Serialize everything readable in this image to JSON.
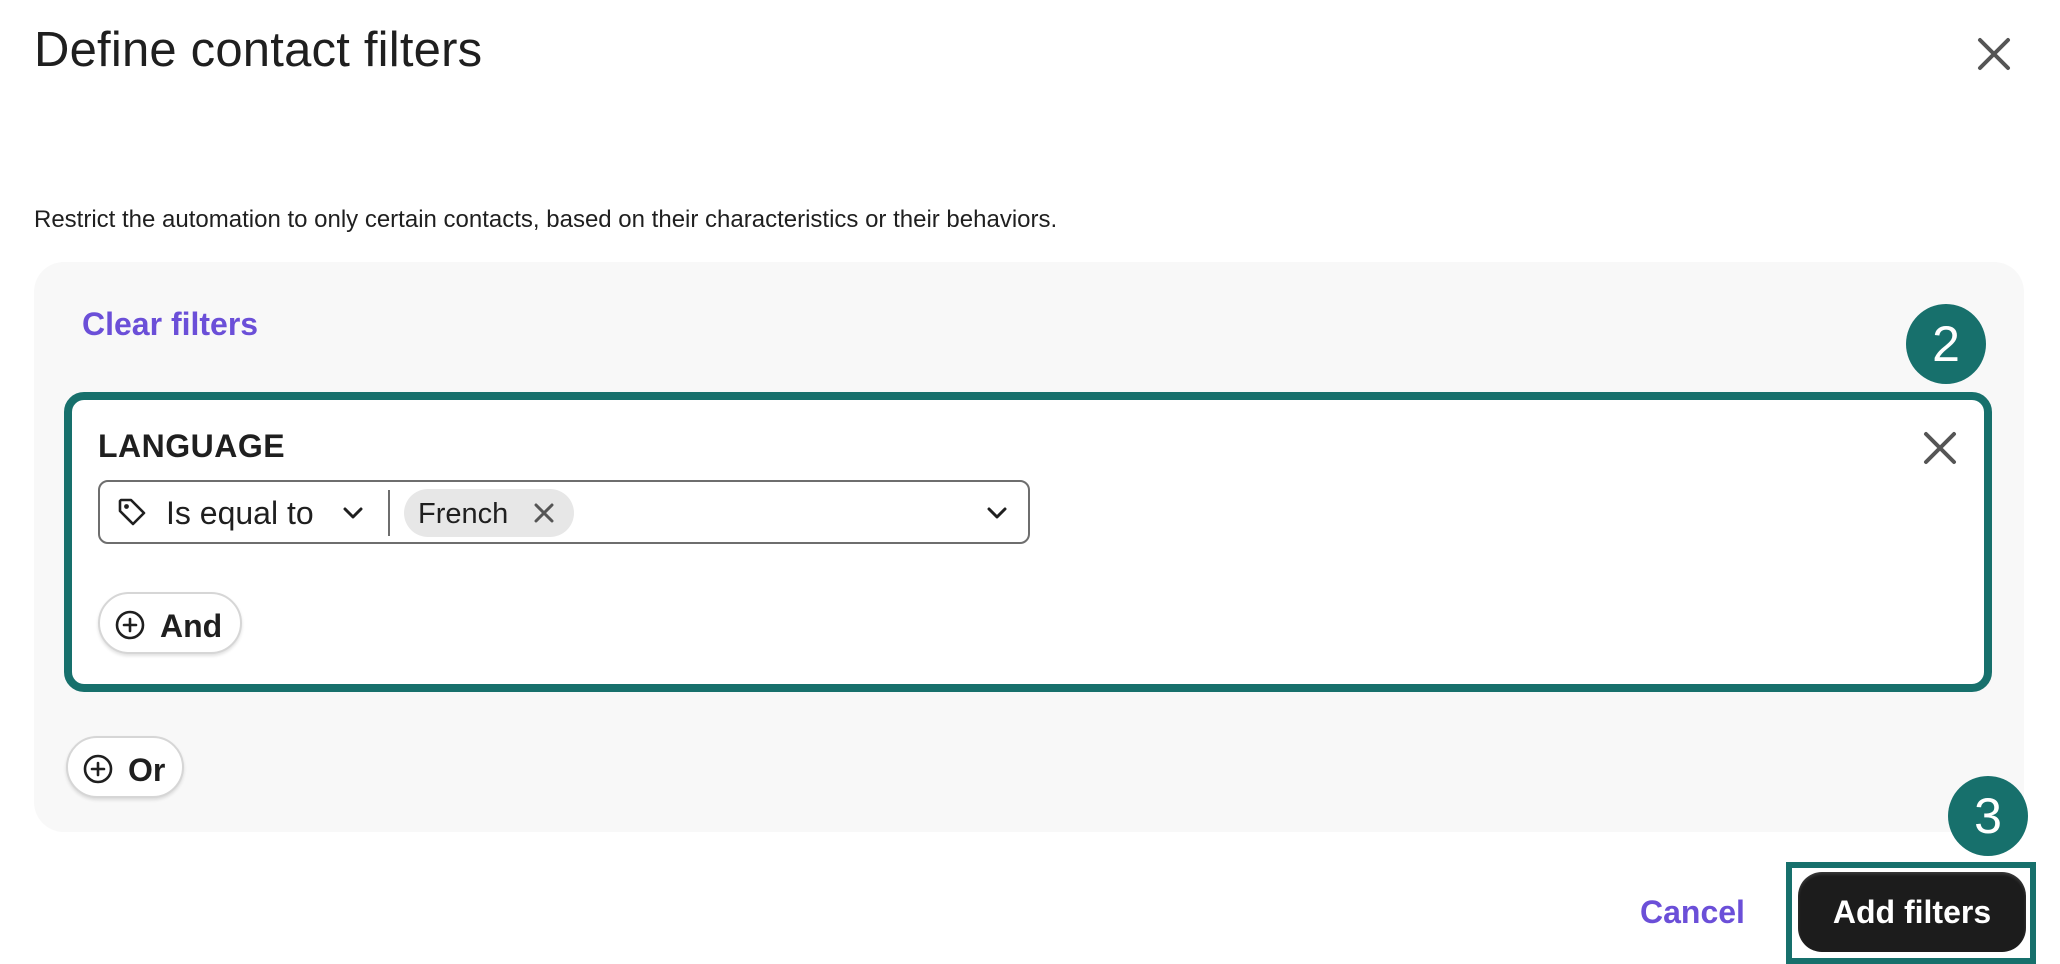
{
  "dialog": {
    "title": "Define contact filters",
    "description": "Restrict the automation to only certain contacts, based on their characteristics or their behaviors."
  },
  "panel": {
    "clear_filters_label": "Clear filters",
    "group": {
      "label": "LANGUAGE",
      "condition": {
        "operator": "Is equal to",
        "values": [
          "French"
        ]
      },
      "and_label": "And"
    },
    "or_label": "Or"
  },
  "footer": {
    "cancel_label": "Cancel",
    "add_label": "Add filters"
  },
  "annotations": {
    "step_2": "2",
    "step_3": "3"
  },
  "colors": {
    "accent_purple": "#6b4fd8",
    "highlight_teal": "#17706c",
    "primary_button": "#1c1c1c"
  },
  "icons": [
    "close-icon",
    "tag-icon",
    "chevron-down-icon",
    "plus-circle-icon"
  ]
}
